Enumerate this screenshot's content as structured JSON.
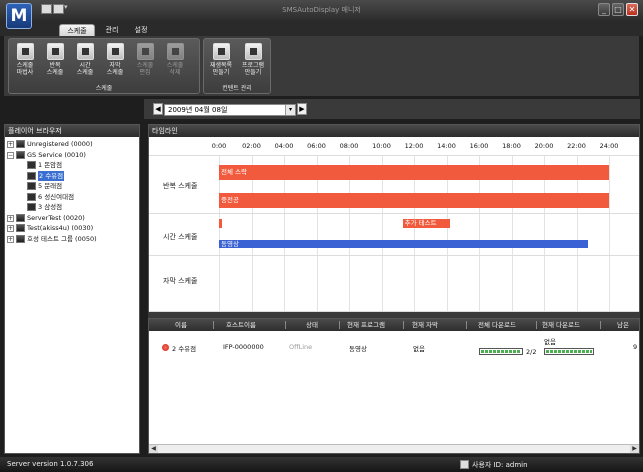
{
  "window": {
    "logo": "M",
    "title": "SMSAutoDisplay 매니저",
    "controls": {
      "minimize": "_",
      "maximize": "□",
      "close": "✕"
    }
  },
  "ribbon": {
    "tabs": [
      {
        "label": "스케줄",
        "active": true
      },
      {
        "label": "관리"
      },
      {
        "label": "설정"
      }
    ],
    "groups": [
      {
        "label": "스케줄",
        "buttons": [
          {
            "label": "스케줄\n마법사",
            "icon": "wand-icon"
          },
          {
            "label": "반복\n스케줄",
            "icon": "repeat-schedule-icon"
          },
          {
            "label": "시간\n스케줄",
            "icon": "time-schedule-icon"
          },
          {
            "label": "자막\n스케줄",
            "icon": "caption-schedule-icon"
          },
          {
            "label": "스케줄\n편집",
            "icon": "edit-schedule-icon",
            "disabled": true
          },
          {
            "label": "스케줄\n삭제",
            "icon": "delete-schedule-icon",
            "disabled": true
          }
        ]
      },
      {
        "label": "컨텐트 관리",
        "buttons": [
          {
            "label": "재생목록\n만들기",
            "icon": "playlist-icon"
          },
          {
            "label": "프로그램\n만들기",
            "icon": "program-icon"
          }
        ]
      }
    ]
  },
  "player_browser": {
    "title": "플레이어 브라우저",
    "tree": [
      {
        "label": "Unregistered (0000)",
        "level": 0,
        "expander": "+"
      },
      {
        "label": "GS Service (0010)",
        "level": 0,
        "expander": "−"
      },
      {
        "label": "1 돈암점",
        "level": 1
      },
      {
        "label": "2 수유점",
        "level": 1,
        "selected": true
      },
      {
        "label": "5 문래점",
        "level": 1
      },
      {
        "label": "6 성신여대점",
        "level": 1
      },
      {
        "label": "3 삼성점",
        "level": 1
      },
      {
        "label": "ServerTest (0020)",
        "level": 0,
        "expander": "+"
      },
      {
        "label": "Test(akiss4u) (0030)",
        "level": 0,
        "expander": "+"
      },
      {
        "label": "호성 테스트 그룹 (0050)",
        "level": 0,
        "expander": "+"
      }
    ]
  },
  "date_nav": {
    "date": "2009년 04월 08일",
    "prev": "◀",
    "next": "▶",
    "dropdown": "▾"
  },
  "timeline": {
    "title": "타임라인",
    "hours": [
      "0:00",
      "02:00",
      "04:00",
      "06:00",
      "08:00",
      "10:00",
      "12:00",
      "14:00",
      "16:00",
      "18:00",
      "20:00",
      "22:00",
      "24:00"
    ],
    "rows": [
      {
        "label": "반복 스케줄",
        "bars": [
          {
            "text": "전체 스락",
            "color": "#f25a3d",
            "start": 0,
            "end": 24
          },
          {
            "text": "중전공",
            "color": "#f25a3d",
            "start": 0,
            "end": 24
          }
        ]
      },
      {
        "label": "시간 스케줄",
        "bars": [
          {
            "text": "추가 테스트",
            "color": "#f25a3d",
            "start": 11.3,
            "end": 14.2
          },
          {
            "text": "동영상",
            "color": "#3b62d4",
            "start": 0,
            "end": 22.7
          }
        ]
      },
      {
        "label": "자막 스케줄",
        "bars": []
      }
    ]
  },
  "table": {
    "columns": [
      "이름",
      "호스트이름",
      "상태",
      "현재 프로그램",
      "현재 자막",
      "전체 다운로드",
      "현재 다운로드",
      "남은"
    ],
    "rows": [
      {
        "name": "2 수유점",
        "host": "IFP-0000000",
        "status": "OffLine",
        "program": "동영상",
        "caption": "없음",
        "total_download": "2/2",
        "total_download_progress": 1.0,
        "current_download_label": "없음",
        "current_download_progress": 1.0,
        "remaining": "9"
      }
    ],
    "status_color": "#d9301e"
  },
  "status_bar": {
    "version": "Server version 1.0.7.306",
    "user": "사용자 ID: admin"
  },
  "colors": {
    "accent_red": "#f25a3d",
    "accent_blue": "#3b62d4",
    "chrome_dark": "#2a2a2a"
  }
}
